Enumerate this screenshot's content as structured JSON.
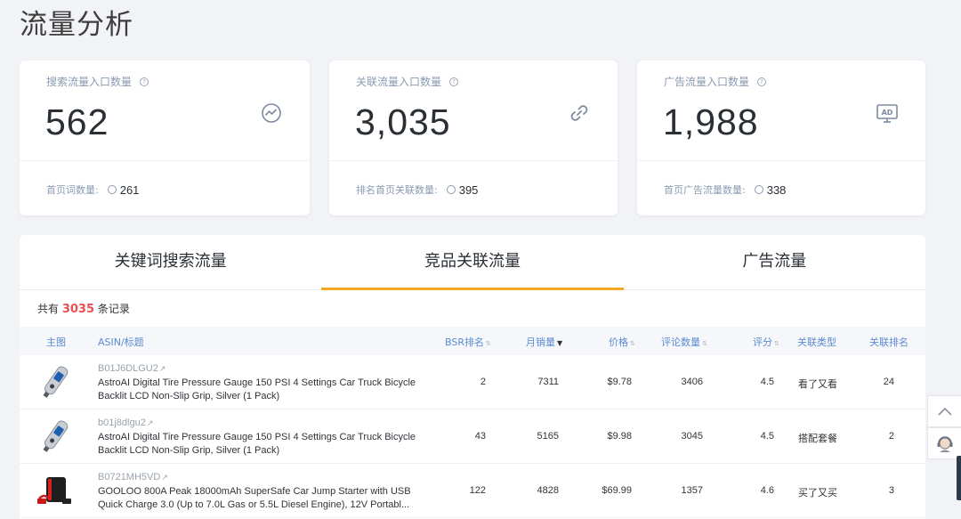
{
  "page": {
    "title": "流量分析"
  },
  "cards": [
    {
      "label": "搜索流量入口数量",
      "value": "562",
      "icon": "trend-icon",
      "foot_label": "首页词数量:",
      "foot_value": "261"
    },
    {
      "label": "关联流量入口数量",
      "value": "3,035",
      "icon": "link-icon",
      "foot_label": "排名首页关联数量:",
      "foot_value": "395"
    },
    {
      "label": "广告流量入口数量",
      "value": "1,988",
      "icon": "ad-icon",
      "foot_label": "首页广告流量数量:",
      "foot_value": "338"
    }
  ],
  "tabs": [
    {
      "label": "关键词搜索流量",
      "active": false
    },
    {
      "label": "竞品关联流量",
      "active": true
    },
    {
      "label": "广告流量",
      "active": false
    }
  ],
  "records": {
    "prefix": "共有",
    "count": "3035",
    "suffix": "条记录"
  },
  "columns": {
    "image": "主图",
    "asin": "ASIN/标题",
    "bsr": "BSR排名",
    "monthly_sales": "月销量",
    "price": "价格",
    "reviews": "评论数量",
    "rating": "评分",
    "relation_type": "关联类型",
    "relation_rank": "关联排名"
  },
  "rows": [
    {
      "asin": "B01J6DLGU2",
      "title_line1": "AstroAI Digital Tire Pressure Gauge 150 PSI 4 Settings Car Truck Bicycle",
      "title_line2": "Backlit LCD Non-Slip Grip, Silver (1 Pack)",
      "bsr": "2",
      "sales": "7311",
      "price": "$9.78",
      "reviews": "3406",
      "rating": "4.5",
      "relation": "看了又看",
      "rank": "24",
      "thumb": "tire-gauge-image"
    },
    {
      "asin": "b01j8dlgu2",
      "title_line1": "AstroAI Digital Tire Pressure Gauge 150 PSI 4 Settings Car Truck Bicycle",
      "title_line2": "Backlit LCD Non-Slip Grip, Silver (1 Pack)",
      "bsr": "43",
      "sales": "5165",
      "price": "$9.98",
      "reviews": "3045",
      "rating": "4.5",
      "relation": "搭配套餐",
      "rank": "2",
      "thumb": "tire-gauge-image"
    },
    {
      "asin": "B0721MH5VD",
      "title_line1": "GOOLOO 800A Peak 18000mAh SuperSafe Car Jump Starter with USB",
      "title_line2": "Quick Charge 3.0 (Up to 7.0L Gas or 5.5L Diesel Engine), 12V Portabl...",
      "bsr": "122",
      "sales": "4828",
      "price": "$69.99",
      "reviews": "1357",
      "rating": "4.6",
      "relation": "买了又买",
      "rank": "3",
      "thumb": "jump-starter-image"
    }
  ],
  "colors": {
    "accent": "#f5a623",
    "highlight": "#e94f4f",
    "header_text": "#5b8bd0"
  }
}
